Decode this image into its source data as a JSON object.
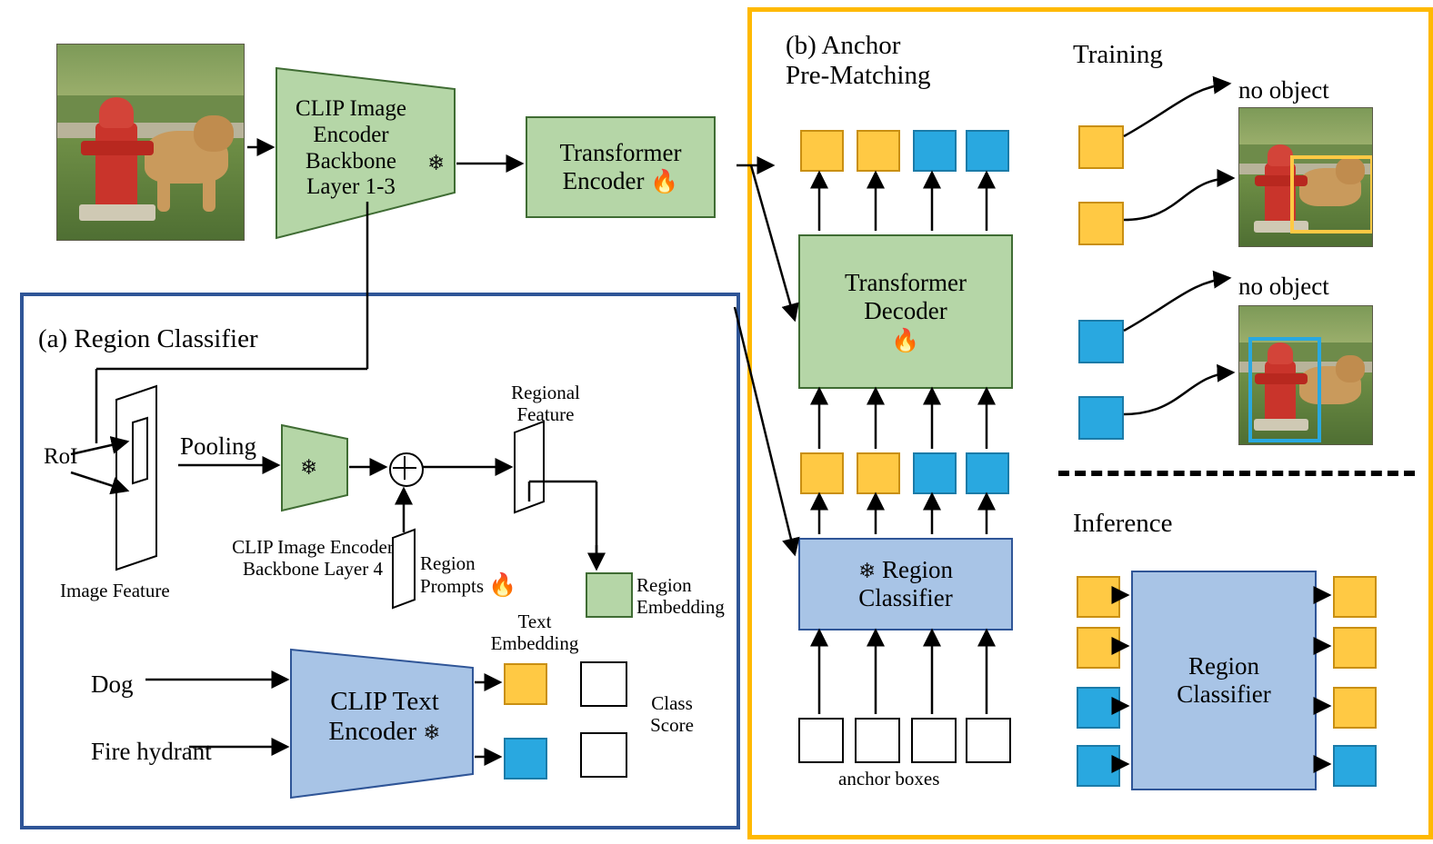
{
  "figure": {
    "panels": {
      "a_label": "(a) Region Classifier",
      "b_label_line1": "(b) Anchor",
      "b_label_line2": "Pre-Matching"
    },
    "top_flow": {
      "clip_image_encoder": "CLIP Image\nEncoder\nBackbone\nLayer 1-3",
      "transformer_encoder": "Transformer\nEncoder",
      "frozen_icon": "snowflake-icon",
      "trainable_icon": "flame-icon"
    },
    "region_classifier": {
      "roi_label": "RoI",
      "pooling_label": "Pooling",
      "image_feature_label": "Image Feature",
      "clip_layer4_line1": "CLIP Image Encoder",
      "clip_layer4_line2": "Backbone Layer 4",
      "region_prompts_label": "Region\nPrompts",
      "regional_feature_label": "Regional\nFeature",
      "region_embedding_label": "Region\nEmbedding",
      "text_embedding_label": "Text\nEmbedding",
      "class_score_label": "Class\nScore",
      "text_inputs": [
        "Dog",
        "Fire hydrant"
      ],
      "clip_text_encoder": "CLIP Text\nEncoder",
      "plus_symbol": "⊕"
    },
    "anchor_prematching": {
      "transformer_decoder": "Transformer\nDecoder",
      "region_classifier": "Region\nClassifier",
      "anchor_boxes_label": "anchor boxes",
      "output_tokens": [
        "yellow",
        "yellow",
        "blue",
        "blue"
      ],
      "mid_tokens": [
        "yellow",
        "yellow",
        "blue",
        "blue"
      ],
      "anchor_tokens": [
        "white",
        "white",
        "white",
        "white"
      ]
    },
    "right_column": {
      "training_label": "Training",
      "inference_label": "Inference",
      "no_object_label_1": "no object",
      "no_object_label_2": "no object",
      "inference_region_classifier": "Region\nClassifier",
      "training_group_1_tokens": [
        "yellow",
        "yellow"
      ],
      "training_group_2_tokens": [
        "blue",
        "blue"
      ],
      "inference_input_tokens": [
        "yellow",
        "yellow",
        "blue",
        "blue"
      ],
      "inference_output_tokens": [
        "yellow",
        "yellow",
        "yellow",
        "blue"
      ]
    },
    "colors": {
      "panel_blue": "#2f5597",
      "panel_yellow": "#ffb900",
      "green_fill": "#b5d6a7",
      "blue_fill": "#a8c4e6",
      "token_yellow": "#ffc944",
      "token_blue": "#29a8e0"
    }
  }
}
